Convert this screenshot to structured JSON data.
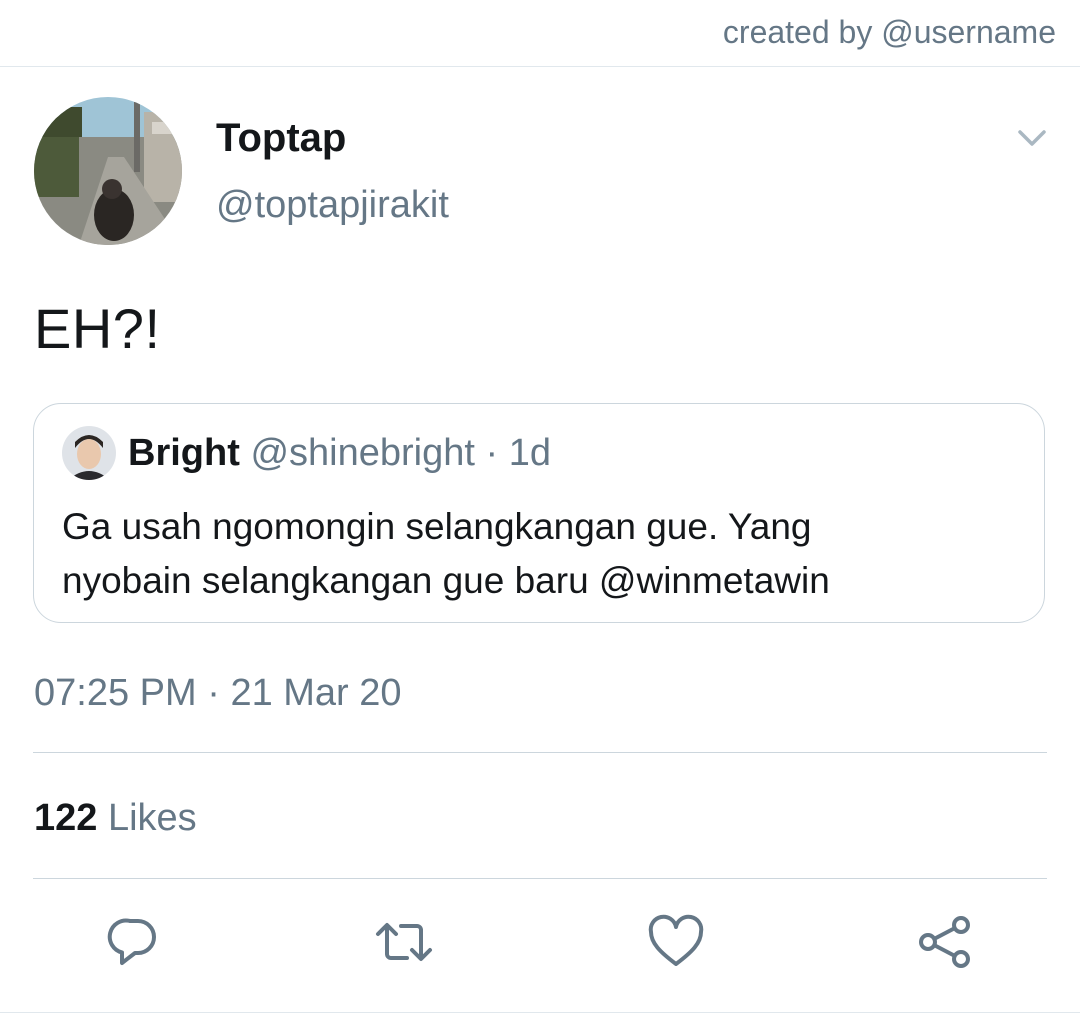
{
  "credit": "created by @username",
  "tweet": {
    "display_name": "Toptap",
    "handle": "@toptapjirakit",
    "text": "EH?!",
    "time": "07:25 PM",
    "separator": "·",
    "date": "21 Mar 20"
  },
  "quote": {
    "display_name": "Bright",
    "handle": "@shinebright",
    "separator": "·",
    "age": "1d",
    "text_lines": [
      "Ga usah ngomongin selangkangan gue. Yang",
      "nyobain selangkangan gue baru @winmetawin"
    ]
  },
  "stats": {
    "likes_count": "122",
    "likes_label": "Likes"
  },
  "actions": {
    "reply_icon": "reply-icon",
    "retweet_icon": "retweet-icon",
    "like_icon": "heart-icon",
    "share_icon": "share-icon"
  },
  "colors": {
    "text_primary": "#14171a",
    "text_secondary": "#657786",
    "border": "#ccd6dd",
    "icon": "#657786"
  }
}
